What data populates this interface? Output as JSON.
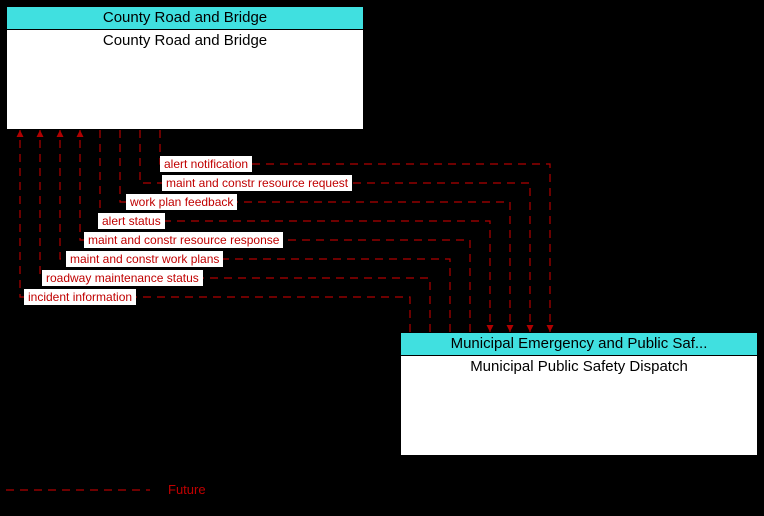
{
  "boxes": {
    "top": {
      "header": "County Road and Bridge",
      "title": "County Road and Bridge",
      "headerColor": "#40E0E0"
    },
    "bottom": {
      "header": "Municipal Emergency and Public Saf...",
      "title": "Municipal Public Safety Dispatch",
      "headerColor": "#40E0E0"
    }
  },
  "flows": [
    "alert notification",
    "maint and constr resource request",
    "work plan feedback",
    "alert status",
    "maint and constr resource response",
    "maint and constr work plans",
    "roadway maintenance status",
    "incident information"
  ],
  "legend": {
    "future": "Future"
  },
  "colors": {
    "flowLine": "#B00000",
    "flowText": "#c00000"
  }
}
